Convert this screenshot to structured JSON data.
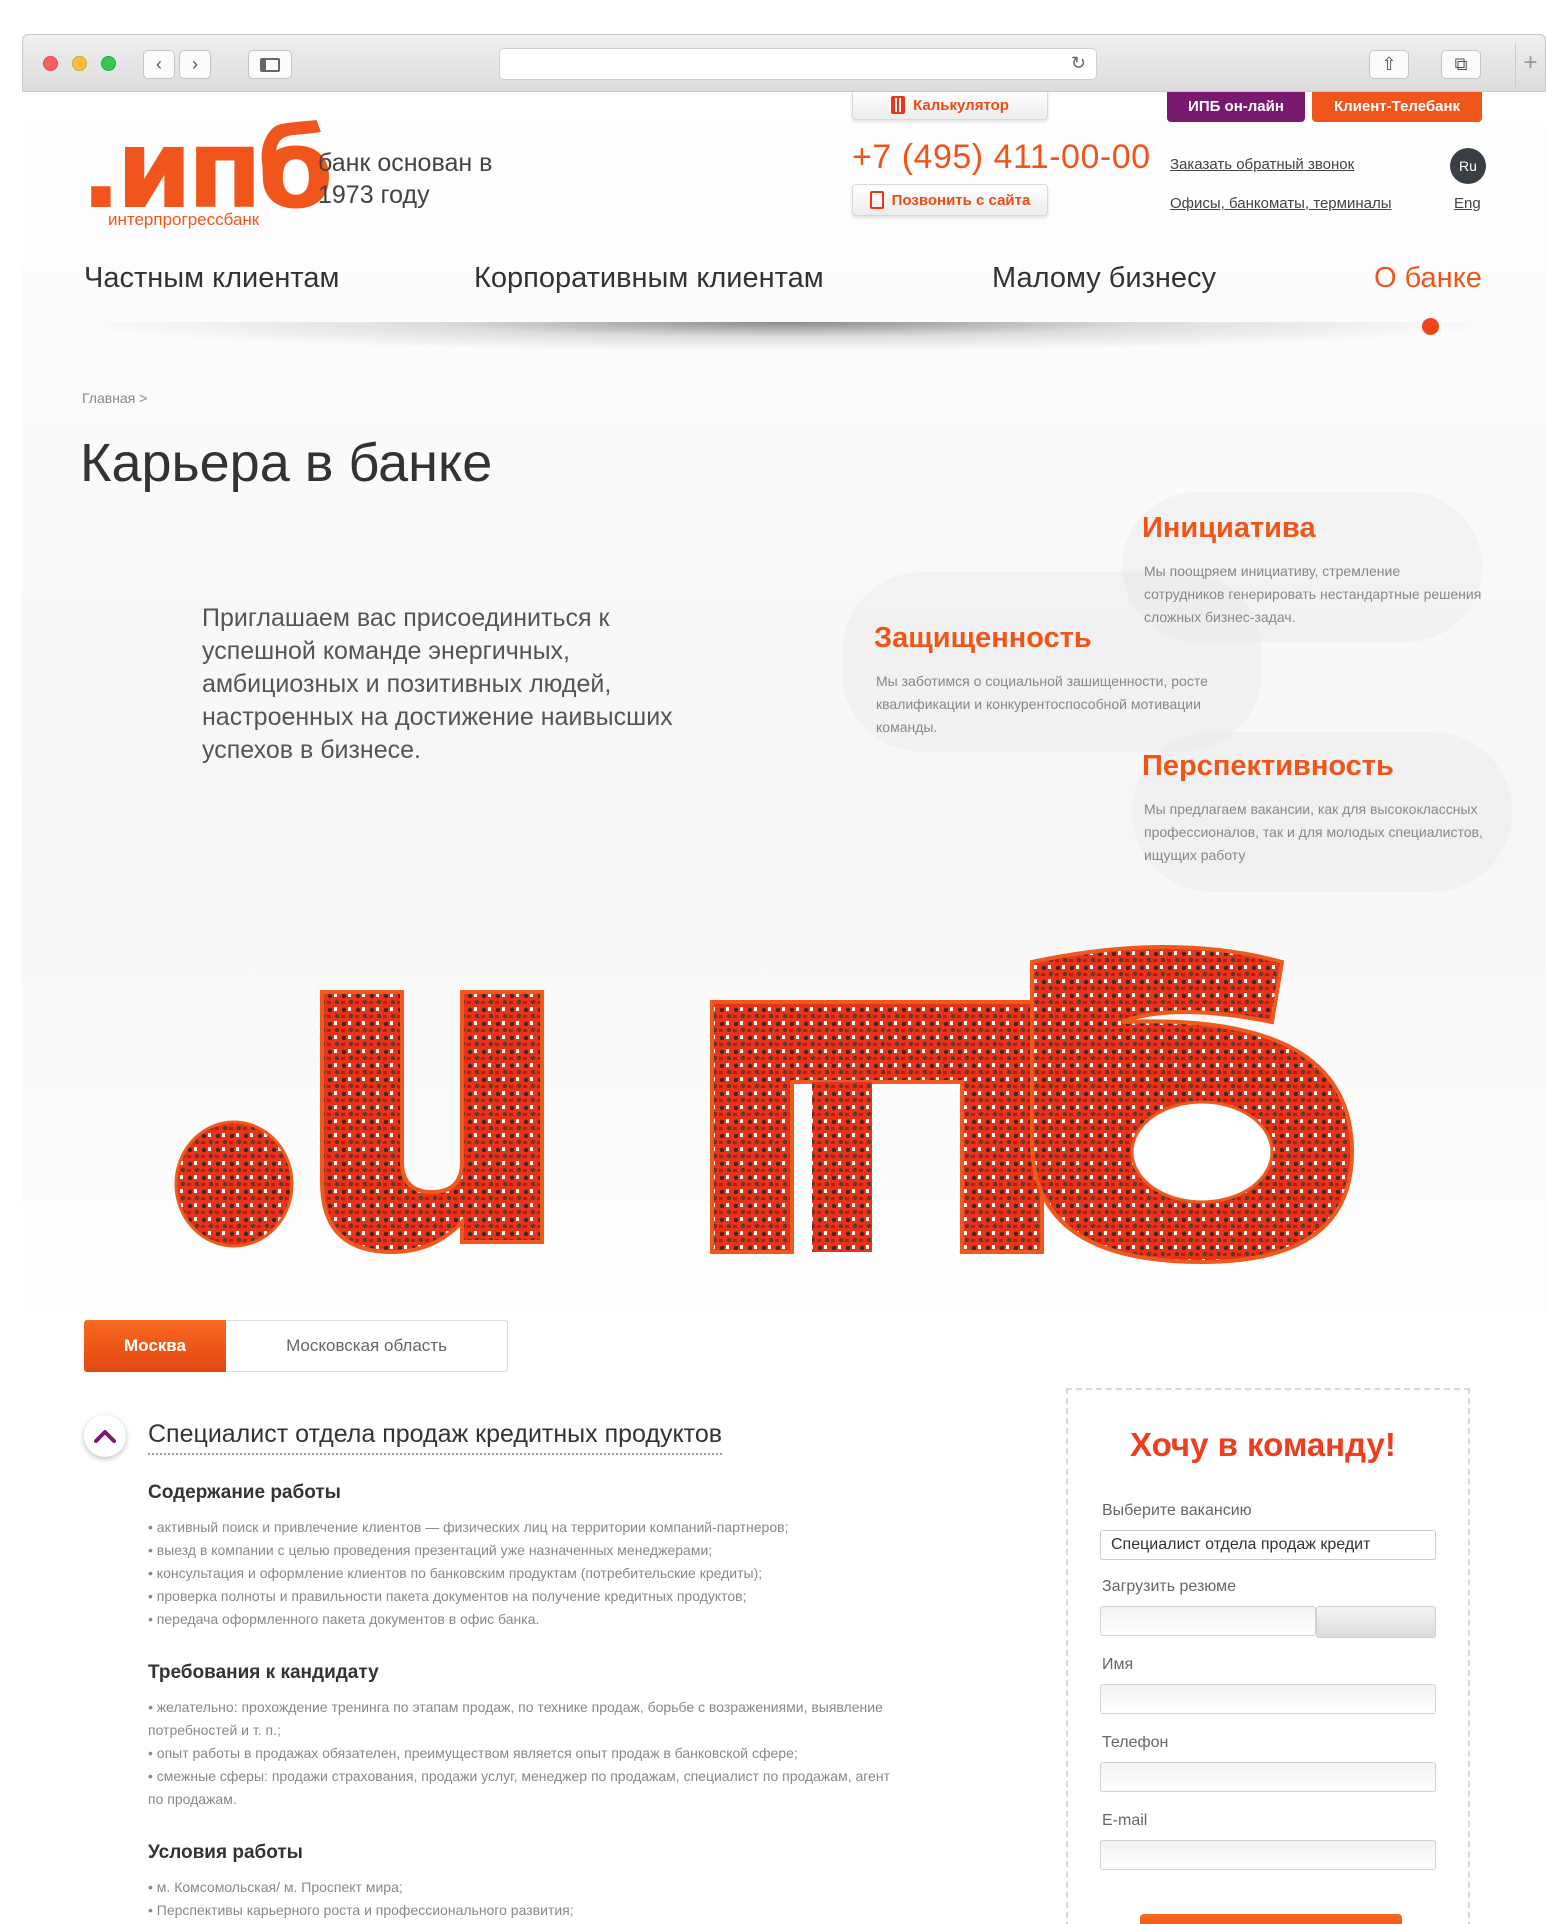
{
  "header": {
    "logo_text": ".ипб",
    "logo_sub": "интерпрогрессбанк",
    "slogan": "банк основан в 1973 году",
    "calculator_label": "Калькулятор",
    "online_label": "ИПБ он-лайн",
    "client_bank_label": "Клиент-Телебанк",
    "phone": "+7 (495) 411-00-00",
    "call_site_label": "Позвонить с сайта",
    "callback_link": "Заказать обратный звонок",
    "offices_link": "Офисы, банкоматы, терминалы",
    "lang_ru": "Ru",
    "lang_en": "Eng"
  },
  "nav": {
    "private": "Частным клиентам",
    "corporate": "Корпоративным клиентам",
    "small_business": "Малому бизнесу",
    "about": "О банке"
  },
  "breadcrumb": "Главная >",
  "page_title": "Карьера в банке",
  "intro": "Приглашаем вас присоединиться к успешной команде энергичных, амбициозных и позитивных людей, настроенных на достижение наивысших успехов в бизнесе.",
  "values": {
    "initiative": {
      "title": "Инициатива",
      "text": "Мы поощряем инициативу, стремление сотрудников генерировать нестандартные решения сложных бизнес-задач."
    },
    "security": {
      "title": "Защищенность",
      "text": "Мы заботимся о социальной зашищенности, росте квалификации и конкурентоспособной мотивации команды."
    },
    "prospects": {
      "title": "Перспективность",
      "text": "Мы предлагаем вакансии, как для высококлассных профессионалов, так и для молодых специалистов, ищущих работу"
    }
  },
  "tabs": {
    "moscow": "Москва",
    "region": "Московская область"
  },
  "vacancy": {
    "title": "Специалист отдела продаж кредитных продуктов",
    "duties_title": "Содержание работы",
    "duties": [
      "• активный поиск и привлечение клиентов — физических лиц на территории компаний-партнеров;",
      "• выезд в компании с целью проведения презентаций уже назначенных менеджерами;",
      "• консультация и оформление клиентов по банковским продуктам (потребительские кредиты);",
      "• проверка полноты и правильности пакета документов на получение кредитных продуктов;",
      "• передача оформленного пакета документов в офис банка."
    ],
    "requirements_title": "Требования к кандидату",
    "requirements": [
      "• желательно: прохождение тренинга по этапам продаж, по технике продаж, борьбе с возражениями, выявление потребностей и т. п.;",
      "• опыт работы в продажах обязателен, преимуществом является опыт продаж в банковской сфере;",
      "• смежные сферы: продажи страхования, продажи услуг, менеджер по продажам, специалист по продажам, агент по продажам."
    ],
    "conditions_title": "Условия работы",
    "conditions": [
      "• м. Комсомольская/ м. Проспект мира;",
      "• Перспективы карьерного роста и профессионального развития;"
    ]
  },
  "form": {
    "title": "Хочу в команду!",
    "vacancy_label": "Выберите вакансию",
    "vacancy_value": "Специалист отдела продаж кредит",
    "resume_label": "Загрузить резюме",
    "name_label": "Имя",
    "phone_label": "Телефон",
    "email_label": "E-mail"
  },
  "colors": {
    "accent": "#ef5519",
    "online_purple": "#7a1a6e",
    "client_bank_orange": "#f0561c"
  }
}
